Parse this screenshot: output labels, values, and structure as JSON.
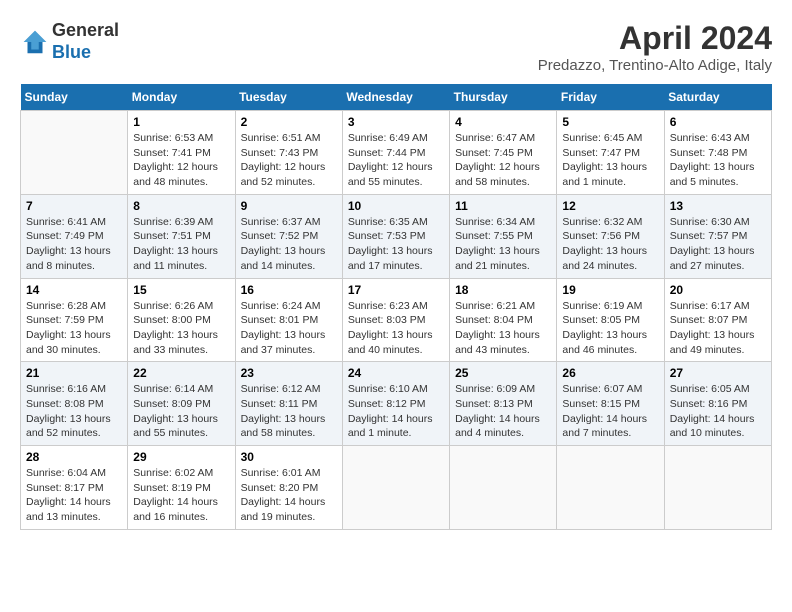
{
  "header": {
    "logo_line1": "General",
    "logo_line2": "Blue",
    "month_year": "April 2024",
    "location": "Predazzo, Trentino-Alto Adige, Italy"
  },
  "days_of_week": [
    "Sunday",
    "Monday",
    "Tuesday",
    "Wednesday",
    "Thursday",
    "Friday",
    "Saturday"
  ],
  "weeks": [
    [
      {
        "day": "",
        "sunrise": "",
        "sunset": "",
        "daylight": ""
      },
      {
        "day": "1",
        "sunrise": "Sunrise: 6:53 AM",
        "sunset": "Sunset: 7:41 PM",
        "daylight": "Daylight: 12 hours and 48 minutes."
      },
      {
        "day": "2",
        "sunrise": "Sunrise: 6:51 AM",
        "sunset": "Sunset: 7:43 PM",
        "daylight": "Daylight: 12 hours and 52 minutes."
      },
      {
        "day": "3",
        "sunrise": "Sunrise: 6:49 AM",
        "sunset": "Sunset: 7:44 PM",
        "daylight": "Daylight: 12 hours and 55 minutes."
      },
      {
        "day": "4",
        "sunrise": "Sunrise: 6:47 AM",
        "sunset": "Sunset: 7:45 PM",
        "daylight": "Daylight: 12 hours and 58 minutes."
      },
      {
        "day": "5",
        "sunrise": "Sunrise: 6:45 AM",
        "sunset": "Sunset: 7:47 PM",
        "daylight": "Daylight: 13 hours and 1 minute."
      },
      {
        "day": "6",
        "sunrise": "Sunrise: 6:43 AM",
        "sunset": "Sunset: 7:48 PM",
        "daylight": "Daylight: 13 hours and 5 minutes."
      }
    ],
    [
      {
        "day": "7",
        "sunrise": "Sunrise: 6:41 AM",
        "sunset": "Sunset: 7:49 PM",
        "daylight": "Daylight: 13 hours and 8 minutes."
      },
      {
        "day": "8",
        "sunrise": "Sunrise: 6:39 AM",
        "sunset": "Sunset: 7:51 PM",
        "daylight": "Daylight: 13 hours and 11 minutes."
      },
      {
        "day": "9",
        "sunrise": "Sunrise: 6:37 AM",
        "sunset": "Sunset: 7:52 PM",
        "daylight": "Daylight: 13 hours and 14 minutes."
      },
      {
        "day": "10",
        "sunrise": "Sunrise: 6:35 AM",
        "sunset": "Sunset: 7:53 PM",
        "daylight": "Daylight: 13 hours and 17 minutes."
      },
      {
        "day": "11",
        "sunrise": "Sunrise: 6:34 AM",
        "sunset": "Sunset: 7:55 PM",
        "daylight": "Daylight: 13 hours and 21 minutes."
      },
      {
        "day": "12",
        "sunrise": "Sunrise: 6:32 AM",
        "sunset": "Sunset: 7:56 PM",
        "daylight": "Daylight: 13 hours and 24 minutes."
      },
      {
        "day": "13",
        "sunrise": "Sunrise: 6:30 AM",
        "sunset": "Sunset: 7:57 PM",
        "daylight": "Daylight: 13 hours and 27 minutes."
      }
    ],
    [
      {
        "day": "14",
        "sunrise": "Sunrise: 6:28 AM",
        "sunset": "Sunset: 7:59 PM",
        "daylight": "Daylight: 13 hours and 30 minutes."
      },
      {
        "day": "15",
        "sunrise": "Sunrise: 6:26 AM",
        "sunset": "Sunset: 8:00 PM",
        "daylight": "Daylight: 13 hours and 33 minutes."
      },
      {
        "day": "16",
        "sunrise": "Sunrise: 6:24 AM",
        "sunset": "Sunset: 8:01 PM",
        "daylight": "Daylight: 13 hours and 37 minutes."
      },
      {
        "day": "17",
        "sunrise": "Sunrise: 6:23 AM",
        "sunset": "Sunset: 8:03 PM",
        "daylight": "Daylight: 13 hours and 40 minutes."
      },
      {
        "day": "18",
        "sunrise": "Sunrise: 6:21 AM",
        "sunset": "Sunset: 8:04 PM",
        "daylight": "Daylight: 13 hours and 43 minutes."
      },
      {
        "day": "19",
        "sunrise": "Sunrise: 6:19 AM",
        "sunset": "Sunset: 8:05 PM",
        "daylight": "Daylight: 13 hours and 46 minutes."
      },
      {
        "day": "20",
        "sunrise": "Sunrise: 6:17 AM",
        "sunset": "Sunset: 8:07 PM",
        "daylight": "Daylight: 13 hours and 49 minutes."
      }
    ],
    [
      {
        "day": "21",
        "sunrise": "Sunrise: 6:16 AM",
        "sunset": "Sunset: 8:08 PM",
        "daylight": "Daylight: 13 hours and 52 minutes."
      },
      {
        "day": "22",
        "sunrise": "Sunrise: 6:14 AM",
        "sunset": "Sunset: 8:09 PM",
        "daylight": "Daylight: 13 hours and 55 minutes."
      },
      {
        "day": "23",
        "sunrise": "Sunrise: 6:12 AM",
        "sunset": "Sunset: 8:11 PM",
        "daylight": "Daylight: 13 hours and 58 minutes."
      },
      {
        "day": "24",
        "sunrise": "Sunrise: 6:10 AM",
        "sunset": "Sunset: 8:12 PM",
        "daylight": "Daylight: 14 hours and 1 minute."
      },
      {
        "day": "25",
        "sunrise": "Sunrise: 6:09 AM",
        "sunset": "Sunset: 8:13 PM",
        "daylight": "Daylight: 14 hours and 4 minutes."
      },
      {
        "day": "26",
        "sunrise": "Sunrise: 6:07 AM",
        "sunset": "Sunset: 8:15 PM",
        "daylight": "Daylight: 14 hours and 7 minutes."
      },
      {
        "day": "27",
        "sunrise": "Sunrise: 6:05 AM",
        "sunset": "Sunset: 8:16 PM",
        "daylight": "Daylight: 14 hours and 10 minutes."
      }
    ],
    [
      {
        "day": "28",
        "sunrise": "Sunrise: 6:04 AM",
        "sunset": "Sunset: 8:17 PM",
        "daylight": "Daylight: 14 hours and 13 minutes."
      },
      {
        "day": "29",
        "sunrise": "Sunrise: 6:02 AM",
        "sunset": "Sunset: 8:19 PM",
        "daylight": "Daylight: 14 hours and 16 minutes."
      },
      {
        "day": "30",
        "sunrise": "Sunrise: 6:01 AM",
        "sunset": "Sunset: 8:20 PM",
        "daylight": "Daylight: 14 hours and 19 minutes."
      },
      {
        "day": "",
        "sunrise": "",
        "sunset": "",
        "daylight": ""
      },
      {
        "day": "",
        "sunrise": "",
        "sunset": "",
        "daylight": ""
      },
      {
        "day": "",
        "sunrise": "",
        "sunset": "",
        "daylight": ""
      },
      {
        "day": "",
        "sunrise": "",
        "sunset": "",
        "daylight": ""
      }
    ]
  ]
}
